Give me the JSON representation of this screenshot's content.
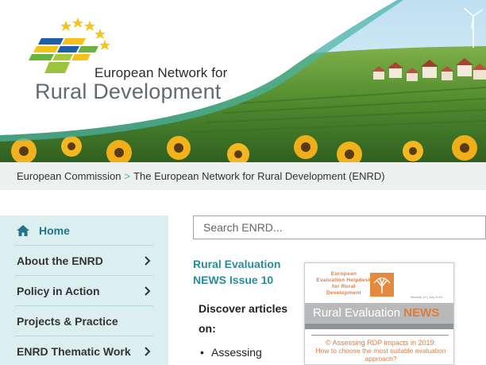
{
  "header": {
    "site_name_line1": "European Network for",
    "site_name_line2": "Rural Development",
    "colors": {
      "teal_accent": "#2b8a9c",
      "brand_grey": "#5f6b74"
    }
  },
  "breadcrumb": {
    "items": [
      "European Commission",
      "The European Network for Rural Development (ENRD)"
    ],
    "separator": ">"
  },
  "sidebar": {
    "items": [
      {
        "label": "Home",
        "icon": "home-icon"
      },
      {
        "label": "About the ENRD",
        "icon": "chevron-right-icon"
      },
      {
        "label": "Policy in Action",
        "icon": "chevron-right-icon"
      },
      {
        "label": "Projects & Practice"
      },
      {
        "label": "ENRD Thematic Work",
        "icon": "chevron-right-icon"
      }
    ]
  },
  "search": {
    "placeholder": "Search ENRD..."
  },
  "main": {
    "news_title": "Rural Evaluation NEWS Issue 10",
    "discover_text": "Discover articles on:",
    "bullets": [
      "Assessing"
    ]
  },
  "thumbnail": {
    "masthead": "European Evaluation Helpdesk for Rural Development",
    "issue": "Number 10 | July 2019",
    "band_left": "Rural Evaluation",
    "band_right": "NEWS",
    "headline_line1": "© Assessing RDP impacts in 2019:",
    "headline_line2": "How to choose the most suitable evaluation approach?"
  }
}
